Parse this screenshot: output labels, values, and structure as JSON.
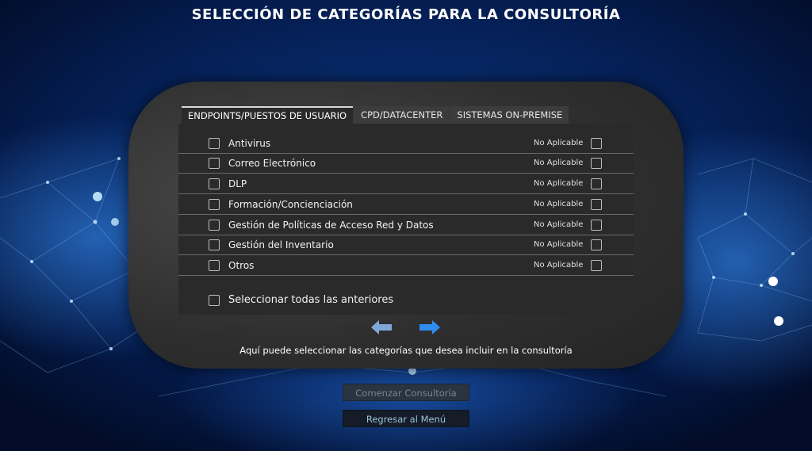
{
  "header": {
    "title": "SELECCIÓN DE CATEGORÍAS PARA LA CONSULTORÍA"
  },
  "tabs": [
    {
      "label": "ENDPOINTS/PUESTOS DE USUARIO",
      "active": true
    },
    {
      "label": "CPD/DATACENTER",
      "active": false
    },
    {
      "label": "SISTEMAS ON-PREMISE",
      "active": false
    }
  ],
  "categories": [
    {
      "label": "Antivirus",
      "na_label": "No Aplicable",
      "checked": false,
      "na_checked": false
    },
    {
      "label": "Correo Electrónico",
      "na_label": "No Aplicable",
      "checked": false,
      "na_checked": false
    },
    {
      "label": "DLP",
      "na_label": "No Aplicable",
      "checked": false,
      "na_checked": false
    },
    {
      "label": "Formación/Concienciación",
      "na_label": "No Aplicable",
      "checked": false,
      "na_checked": false
    },
    {
      "label": "Gestión de Políticas de Acceso Red y Datos",
      "na_label": "No Aplicable",
      "checked": false,
      "na_checked": false
    },
    {
      "label": "Gestión del Inventario",
      "na_label": "No Aplicable",
      "checked": false,
      "na_checked": false
    },
    {
      "label": "Otros",
      "na_label": "No Aplicable",
      "checked": false,
      "na_checked": false
    }
  ],
  "select_all": {
    "label": "Seleccionar todas las anteriores",
    "checked": false
  },
  "navigation": {
    "prev_icon": "arrow-left-icon",
    "next_icon": "arrow-right-icon"
  },
  "hint": "Aquí puede seleccionar las categorías que desea incluir en la consultoría",
  "buttons": {
    "start": "Comenzar Consultoría",
    "back": "Regresar al Menú"
  },
  "colors": {
    "arrow_prev": "#7fa8d8",
    "arrow_next": "#2f8cf0",
    "accent_bg": "#0a3a8a"
  }
}
